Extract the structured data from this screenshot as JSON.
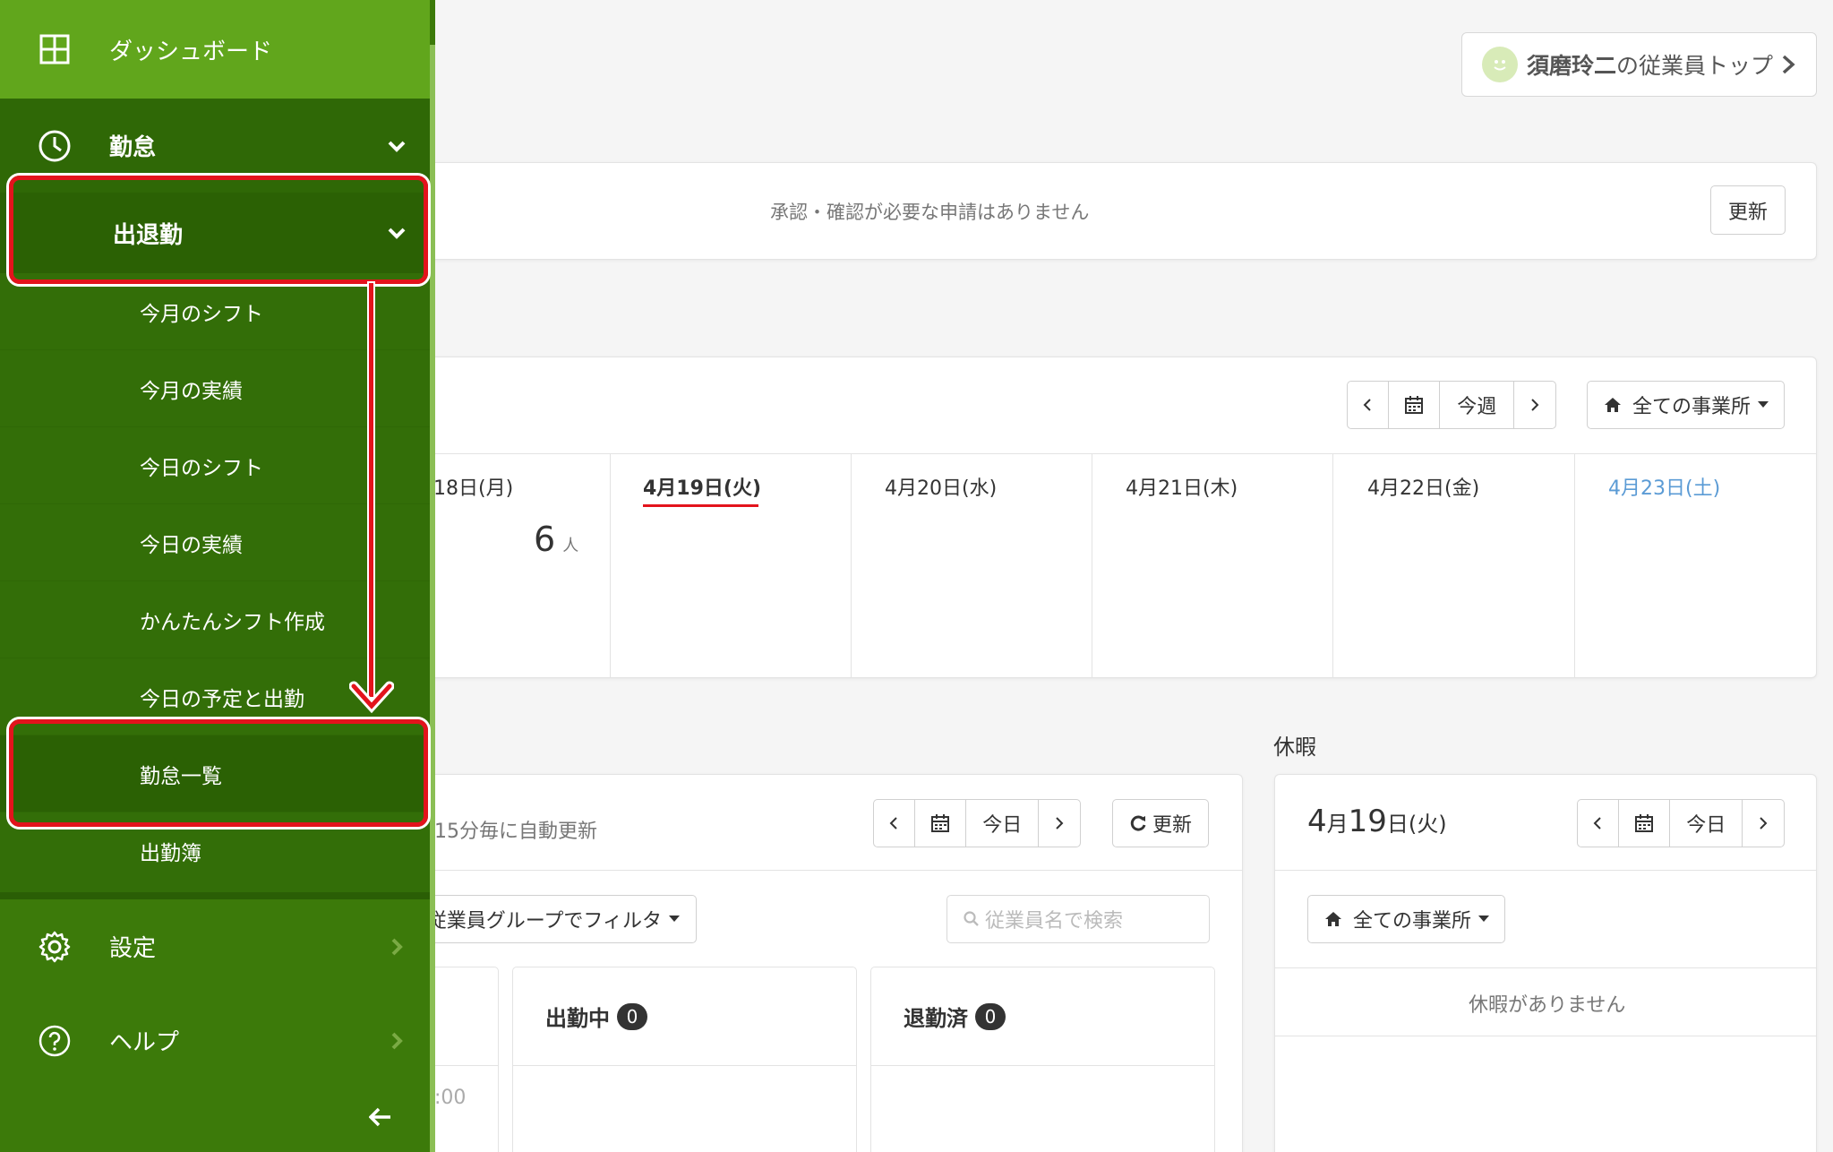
{
  "header": {
    "employee_top_name": "須磨玲二",
    "employee_top_suffix": "の従業員トップ"
  },
  "notice": {
    "message": "承認・確認が必要な申請はありません",
    "refresh_label": "更新"
  },
  "week": {
    "today_label": "今週",
    "office_filter": "全ての事業所",
    "days": [
      {
        "label": "18日(月)",
        "count": "6",
        "unit": "人"
      },
      {
        "label": "4月19日(火)"
      },
      {
        "label": "4月20日(水)"
      },
      {
        "label": "4月21日(木)"
      },
      {
        "label": "4月22日(金)"
      },
      {
        "label": "4月23日(土)"
      }
    ]
  },
  "attendance": {
    "auto_update": "15分毎に自動更新",
    "today_label": "今日",
    "refresh_label": "更新",
    "group_filter": "従業員グループでフィルタ",
    "search_placeholder": "従業員名で検索",
    "partial_time": ":00",
    "working_label": "出勤中",
    "working_count": "0",
    "finished_label": "退勤済",
    "finished_count": "0"
  },
  "vacation": {
    "section_title": "休暇",
    "date_month": "4",
    "date_m_unit": "月",
    "date_day": "19",
    "date_d_unit": "日(火)",
    "today_label": "今日",
    "office_filter": "全ての事業所",
    "empty_message": "休暇がありません"
  },
  "sidebar": {
    "dashboard": "ダッシュボード",
    "attendance": "勤怠",
    "clock_in_out": "出退勤",
    "sub_items": [
      "今月のシフト",
      "今月の実績",
      "今日のシフト",
      "今日の実績",
      "かんたんシフト作成",
      "今日の予定と出勤",
      "勤怠一覧",
      "出勤簿"
    ],
    "settings": "設定",
    "help": "ヘルプ"
  },
  "colors": {
    "sidebar_bg": "#3c7a0a",
    "sidebar_active": "#61a61c",
    "highlight": "#e3131c",
    "saturday_blue": "#5b9bd5"
  }
}
